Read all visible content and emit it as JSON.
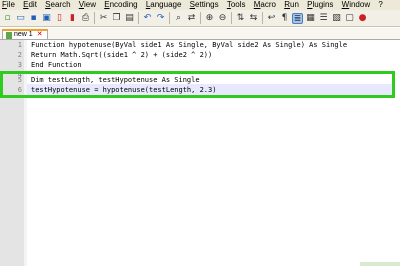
{
  "menubar": {
    "items": [
      "File",
      "Edit",
      "Search",
      "View",
      "Encoding",
      "Language",
      "Settings",
      "Tools",
      "Macro",
      "Run",
      "Plugins",
      "Window",
      "?"
    ]
  },
  "toolbar": {
    "icons": [
      "new-file-icon",
      "open-icon",
      "save-icon",
      "save-all-icon",
      "close-icon",
      "close-all-icon",
      "print-icon",
      "cut-icon",
      "copy-icon",
      "paste-icon",
      "undo-icon",
      "redo-icon",
      "find-icon",
      "replace-icon",
      "zoom-in-icon",
      "zoom-out-icon",
      "sync-v-icon",
      "sync-h-icon",
      "word-wrap-icon",
      "show-all-chars-icon",
      "indent-guide-icon",
      "folder-icon",
      "function-list-icon",
      "doc-map-icon",
      "monitor-icon",
      "record-macro-icon"
    ]
  },
  "tab": {
    "label": "new 1"
  },
  "editor": {
    "lines": [
      {
        "n": "1",
        "text": "Function hypotenuse(ByVal side1 As Single, ByVal side2 As Single) As Single"
      },
      {
        "n": "2",
        "text": "Return Math.Sqrt((side1 ^ 2) + (side2 ^ 2))"
      },
      {
        "n": "3",
        "text": "End Function"
      },
      {
        "n": "4",
        "text": ""
      },
      {
        "n": "5",
        "text": "Dim testLength, testHypotenuse As Single"
      },
      {
        "n": "6",
        "text": "testHypotenuse = hypotenuse(testLength, 2.3)"
      }
    ]
  },
  "colors": {
    "highlight_border": "#2ecc1f",
    "tab_accent": "#f0a030"
  }
}
